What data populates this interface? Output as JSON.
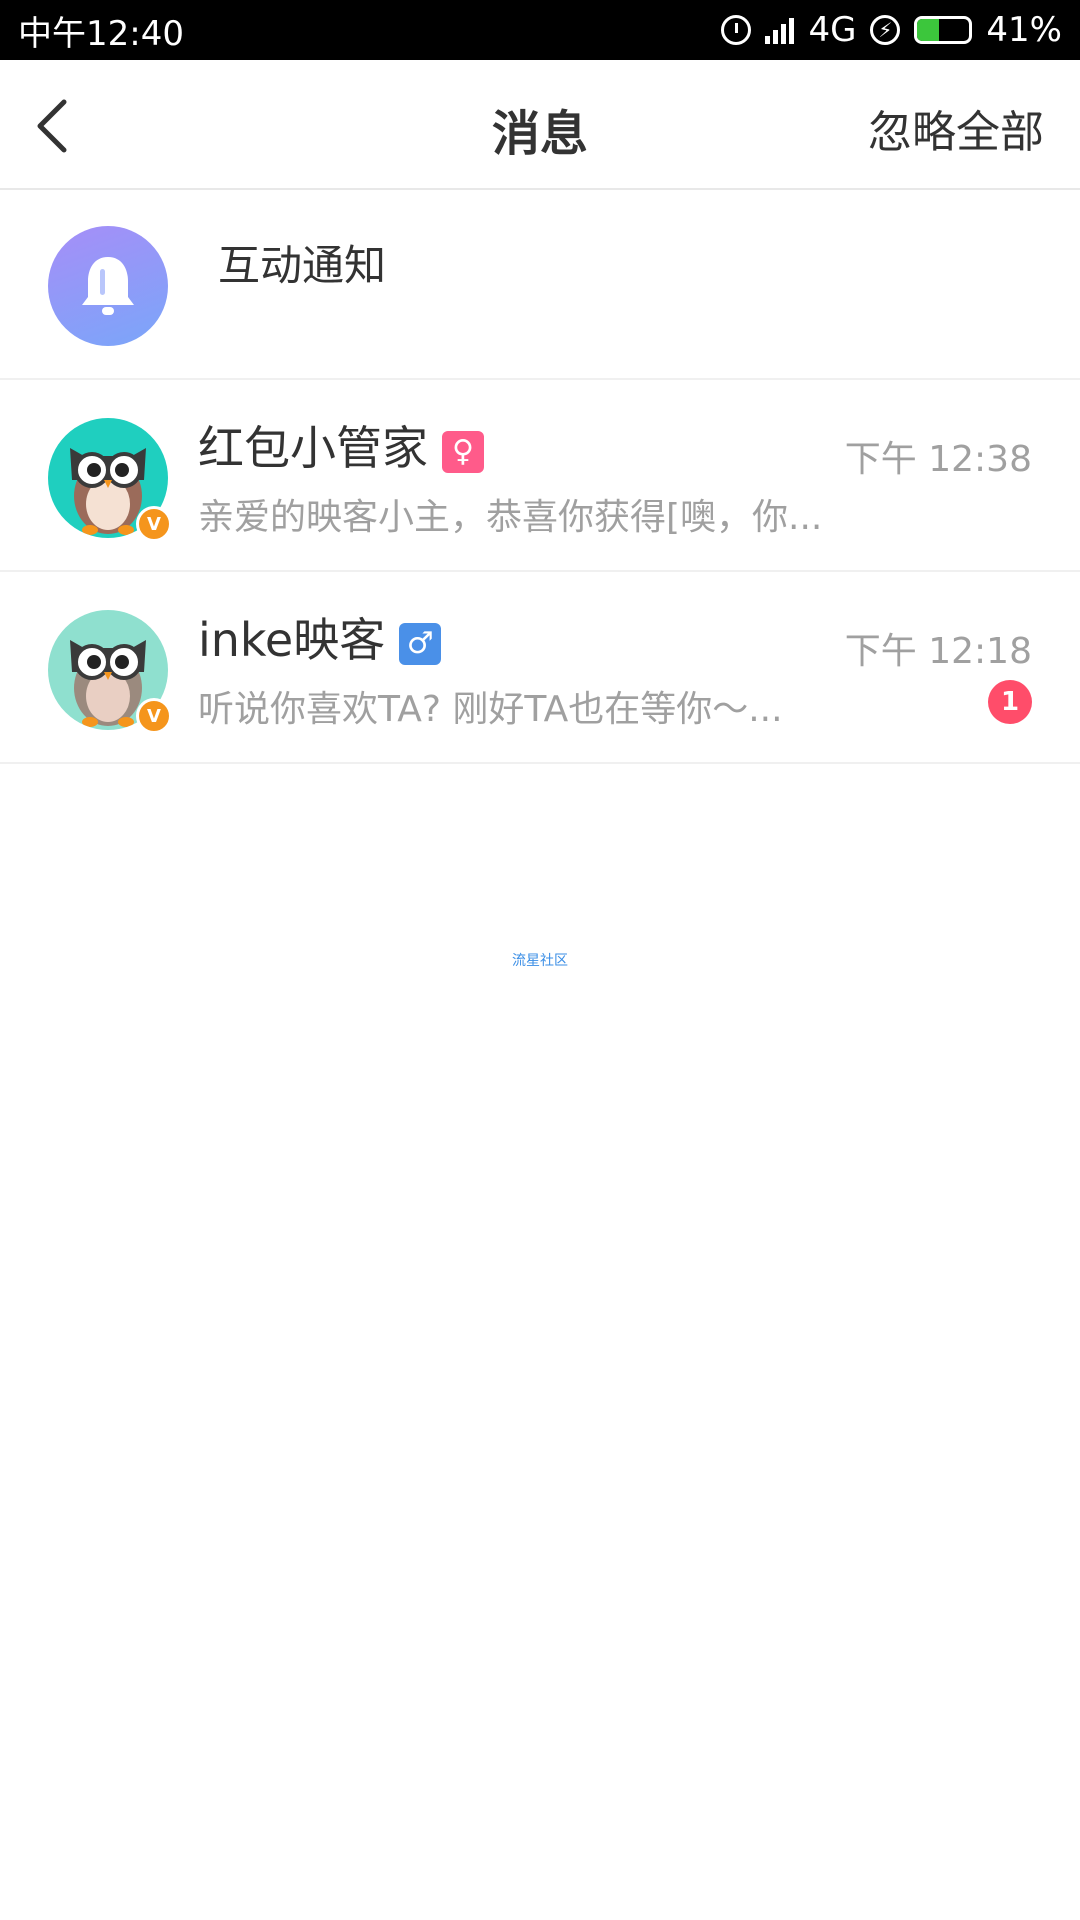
{
  "status_bar": {
    "time": "中午12:40",
    "network": "4G",
    "battery_text": "41%",
    "battery_level": 0.41
  },
  "header": {
    "title": "消息",
    "ignore_all": "忽略全部"
  },
  "notification": {
    "label": "互动通知"
  },
  "conversations": [
    {
      "name": "红包小管家",
      "gender": "female",
      "time": "下午 12:38",
      "preview": "亲爱的映客小主，恭喜你获得[噢，你...",
      "badge_letter": "V",
      "avatar_bg": "#1fcfbf"
    },
    {
      "name": "inke映客",
      "gender": "male",
      "time": "下午 12:18",
      "preview": "听说你喜欢TA? 刚好TA也在等你～...",
      "badge_letter": "V",
      "avatar_bg": "#8fe0cf",
      "unread": "1"
    }
  ],
  "watermark": "流星社区",
  "colors": {
    "unread": "#ff4d6a",
    "female": "#ff5b8a",
    "male": "#4a90e8",
    "badge": "#f5951c"
  }
}
